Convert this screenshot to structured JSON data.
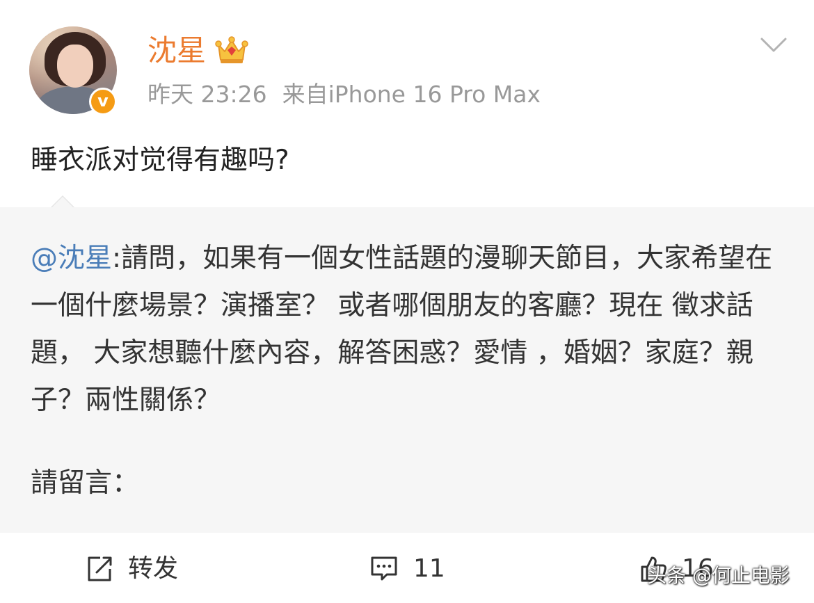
{
  "post": {
    "author": {
      "name": "沈星",
      "verified_badge": "v",
      "crown_icon": "crown-icon"
    },
    "meta": {
      "time": "昨天 23:26",
      "source": "来自iPhone 16 Pro Max"
    },
    "text": "睡衣派对觉得有趣吗?",
    "repost": {
      "mention": "@沈星",
      "body": ":請問，如果有一個女性話題的漫聊天節目，大家希望在一個什麼場景？演播室？ 或者哪個朋友的客廳？現在 徵求話題， 大家想聽什麼內容，解答困惑？愛情 ，婚姻？家庭？親子？兩性關係？",
      "footer": "請留言："
    },
    "actions": {
      "repost_label": "转发",
      "comment_count": "11",
      "like_count": "16"
    }
  },
  "watermark": "头条 @何止电影",
  "colors": {
    "username": "#eb7b2f",
    "badge": "#f59b14",
    "mention": "#4a7db8",
    "meta": "#999999",
    "repost_bg": "#f6f6f6"
  }
}
